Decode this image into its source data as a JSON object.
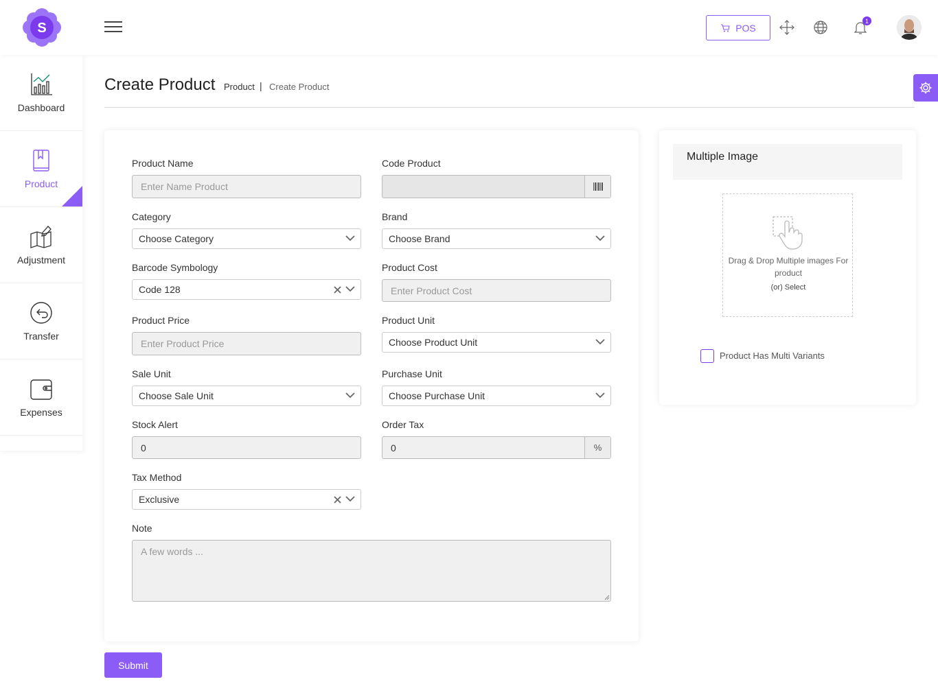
{
  "brand": {
    "logo_letter": "S",
    "accent": "#8b5cf6"
  },
  "topbar": {
    "pos_label": "POS",
    "notification_count": "1"
  },
  "sidebar": {
    "items": [
      {
        "label": "Dashboard",
        "icon": "bar-chart-icon"
      },
      {
        "label": "Product",
        "icon": "book-icon",
        "active": true
      },
      {
        "label": "Adjustment",
        "icon": "map-edit-icon"
      },
      {
        "label": "Transfer",
        "icon": "transfer-icon"
      },
      {
        "label": "Expenses",
        "icon": "wallet-icon"
      }
    ]
  },
  "page": {
    "title": "Create Product",
    "breadcrumb": [
      "Product",
      "Create Product"
    ],
    "breadcrumb_sep": "|"
  },
  "form": {
    "product_name": {
      "label": "Product Name",
      "placeholder": "Enter Name Product"
    },
    "code_product": {
      "label": "Code Product",
      "value": ""
    },
    "category": {
      "label": "Category",
      "value": "Choose Category"
    },
    "brand": {
      "label": "Brand",
      "value": "Choose Brand"
    },
    "barcode": {
      "label": "Barcode Symbology",
      "value": "Code 128"
    },
    "product_cost": {
      "label": "Product Cost",
      "placeholder": "Enter Product Cost"
    },
    "product_price": {
      "label": "Product Price",
      "placeholder": "Enter Product Price"
    },
    "product_unit": {
      "label": "Product Unit",
      "value": "Choose Product Unit"
    },
    "sale_unit": {
      "label": "Sale Unit",
      "value": "Choose Sale Unit"
    },
    "purchase_unit": {
      "label": "Purchase Unit",
      "value": "Choose Purchase Unit"
    },
    "stock_alert": {
      "label": "Stock Alert",
      "value": "0"
    },
    "order_tax": {
      "label": "Order Tax",
      "value": "0",
      "addon": "%"
    },
    "tax_method": {
      "label": "Tax Method",
      "value": "Exclusive"
    },
    "note": {
      "label": "Note",
      "placeholder": "A few words ..."
    },
    "submit_label": "Submit"
  },
  "images": {
    "title": "Multiple Image",
    "drop_text": "Drag & Drop Multiple images For product",
    "select_text": "(or) Select",
    "multi_variants_label": "Product Has Multi Variants"
  }
}
